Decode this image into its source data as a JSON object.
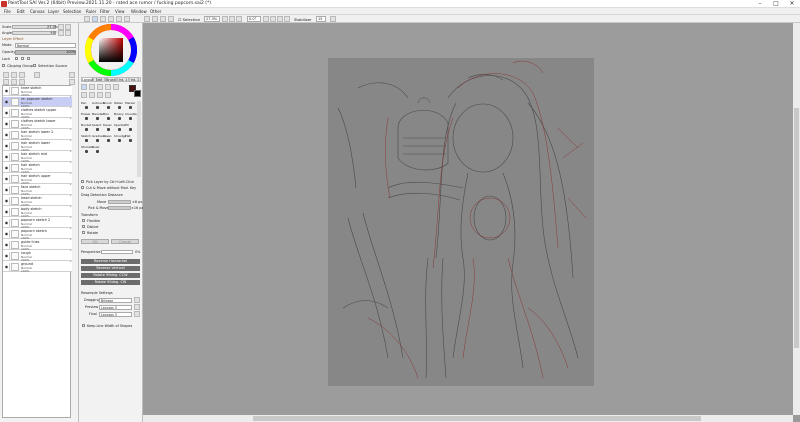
{
  "window": {
    "title": "PaintTool SAI Ver.2 (64bit) Preview.2021.11.20 - rated ace rumor / fucking popcorn.sai2 (*)",
    "minimize": "–",
    "maximize": "□",
    "close": "✕"
  },
  "menu": [
    "File",
    "Edit",
    "Canvas",
    "Layer",
    "Selection",
    "Ruler",
    "Filter",
    "View",
    "Window",
    "Other"
  ],
  "toolbar": {
    "selection_label": "Selection",
    "zoom_value": "27.3%",
    "rotate_value": "0.0°",
    "stabilizer_label": "Stabilizer",
    "stabilizer_value": "15"
  },
  "navigator": {
    "scale_label": "Scale",
    "scale_value": "27.3%",
    "angle_label": "Angle",
    "angle_value": "+0°"
  },
  "layer_effect": {
    "header": "Layer Effect",
    "mode_label": "Mode",
    "mode_value": "Normal",
    "opacity_label": "Opacity",
    "opacity_value": "100%",
    "lock_label": "Lock",
    "clipping_label": "Clipping Group",
    "selection_source_label": "Selection Source"
  },
  "layers": [
    {
      "name": "knee sketch",
      "mode": "Normal",
      "opacity": "100%",
      "selected": false
    },
    {
      "name": "re: popcorn sketch",
      "mode": "Normal",
      "opacity": "100%",
      "selected": true
    },
    {
      "name": "clothes sketch upper",
      "mode": "Normal",
      "opacity": "100%",
      "selected": false
    },
    {
      "name": "clothes sketch lower",
      "mode": "Normal",
      "opacity": "100%",
      "selected": false
    },
    {
      "name": "hair sketch lower 2",
      "mode": "Normal",
      "opacity": "100%",
      "selected": false
    },
    {
      "name": "hair sketch lower",
      "mode": "Normal",
      "opacity": "100%",
      "selected": false
    },
    {
      "name": "hair sketch mid",
      "mode": "Normal",
      "opacity": "100%",
      "selected": false
    },
    {
      "name": "hair sketch",
      "mode": "Normal",
      "opacity": "100%",
      "selected": false
    },
    {
      "name": "hair sketch upper",
      "mode": "Normal",
      "opacity": "100%",
      "selected": false
    },
    {
      "name": "face sketch",
      "mode": "Normal",
      "opacity": "100%",
      "selected": false
    },
    {
      "name": "head sketch",
      "mode": "Normal",
      "opacity": "100%",
      "selected": false
    },
    {
      "name": "body sketch",
      "mode": "Normal",
      "opacity": "100%",
      "selected": false
    },
    {
      "name": "popcorn sketch 2",
      "mode": "Normal",
      "opacity": "100%",
      "selected": false
    },
    {
      "name": "popcorn sketch",
      "mode": "Normal",
      "opacity": "100%",
      "selected": false
    },
    {
      "name": "guide lines",
      "mode": "Normal",
      "opacity": "100%",
      "selected": false
    },
    {
      "name": "rough",
      "mode": "Normal",
      "opacity": "100%",
      "selected": false
    },
    {
      "name": "ground",
      "mode": "Normal",
      "opacity": "100%",
      "selected": false
    }
  ],
  "tool_tabs": [
    "Layout",
    "Edit",
    "Brush",
    "Int. 1",
    "Int. 2"
  ],
  "tool_grid": [
    "Pen",
    "Airbrush",
    "Brush",
    "Water",
    "Marker",
    "Eraser",
    "Blender",
    "Blur",
    "Binary",
    "Cloudburst",
    "Bucket",
    "Select",
    "Desel",
    "Sparkle",
    "Fill",
    "Sketch",
    "Gradient",
    "Lasso",
    "Smudge",
    "Flat",
    "Sfumato",
    "Ruler"
  ],
  "tool_options": {
    "pick_layer": "Pick Layer by Ctrl+Left-Click",
    "cut_move": "Cut & Move without Mod. Key",
    "drag_detection": "Drag Detection Distance",
    "move_label": "Move",
    "move_value": "±8 px",
    "pick_move_label": "Pick & Move",
    "pick_move_value": "±16 px",
    "transform_header": "Transform",
    "options": [
      "Flexible",
      "Distort",
      "Rotate"
    ],
    "ok": "OK",
    "cancel": "Cancel",
    "perspective_label": "Perspective",
    "perspective_value": "0%",
    "buttons": [
      "Reverse Horizontal",
      "Reverse Vertical",
      "Rotate 90deg. CCW",
      "Rotate 90deg. CW"
    ],
    "resample_header": "Resample Settings",
    "dragging_label": "Dragging",
    "dragging_value": "Bilinear",
    "preview_label": "Preview",
    "preview_value": "Lanczos 3",
    "final_label": "Final",
    "final_value": "Lanczos 3",
    "keep_line_width": "Keep Line Width of Shapes"
  },
  "colors": {
    "accent": "#c8cdf5",
    "fg_color": "#4a1010",
    "bg_color": "#000000",
    "paper": "#878787"
  }
}
